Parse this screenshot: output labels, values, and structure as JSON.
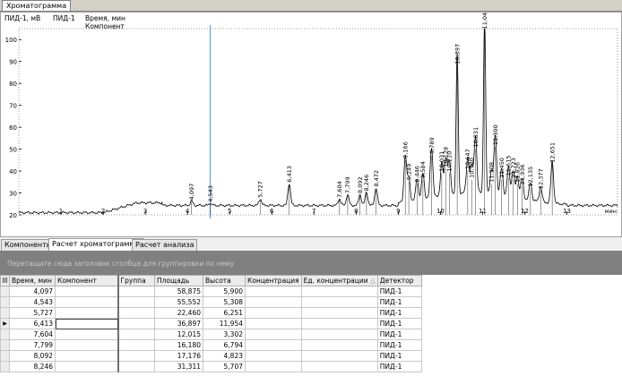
{
  "window": {
    "tab_label": "Хроматограмма"
  },
  "chromatogram": {
    "channel_unit": "ПИД-1, мВ",
    "detector": "ПИД-1",
    "time_label": "Время, мин",
    "component_label": "Компонент",
    "x_axis_unit": "мин",
    "chart_data": {
      "type": "line",
      "title": "",
      "xlabel": "Время, мин",
      "ylabel": "ПИД-1, мВ",
      "xlim": [
        0,
        14.2
      ],
      "ylim": [
        20,
        105
      ],
      "y_ticks": [
        20,
        30,
        40,
        50,
        60,
        70,
        80,
        90,
        100
      ],
      "x_ticks": [
        1,
        2,
        3,
        4,
        5,
        6,
        7,
        8,
        9,
        10,
        11,
        12,
        13
      ],
      "cursor_x": 4.54,
      "baseline": 21,
      "peaks": [
        {
          "x": 4.097,
          "y": 26,
          "label": "4,097"
        },
        {
          "x": 4.543,
          "y": 25,
          "label": "4,543"
        },
        {
          "x": 5.727,
          "y": 27,
          "label": "5,727"
        },
        {
          "x": 6.413,
          "y": 34,
          "label": "6,413"
        },
        {
          "x": 7.604,
          "y": 27,
          "label": "7,604"
        },
        {
          "x": 7.799,
          "y": 29,
          "label": "7,799"
        },
        {
          "x": 8.092,
          "y": 29,
          "label": "8,092"
        },
        {
          "x": 8.246,
          "y": 30,
          "label": "8,246"
        },
        {
          "x": 8.472,
          "y": 32,
          "label": "8,472"
        },
        {
          "x": 9.166,
          "y": 45,
          "label": "9,166"
        },
        {
          "x": 9.249,
          "y": 35,
          "label": "9,249"
        },
        {
          "x": 9.446,
          "y": 34,
          "label": "9,446"
        },
        {
          "x": 9.584,
          "y": 36,
          "label": "9,584"
        },
        {
          "x": 9.789,
          "y": 47,
          "label": "9,789"
        },
        {
          "x": 10.031,
          "y": 39,
          "label": "10,031"
        },
        {
          "x": 10.128,
          "y": 41,
          "label": "10,128"
        },
        {
          "x": 10.21,
          "y": 39,
          "label": "10,210"
        },
        {
          "x": 10.397,
          "y": 88,
          "label": "10,397"
        },
        {
          "x": 10.647,
          "y": 40,
          "label": "10,647"
        },
        {
          "x": 10.74,
          "y": 36,
          "label": "10,740"
        },
        {
          "x": 10.831,
          "y": 50,
          "label": "10,831"
        },
        {
          "x": 11.047,
          "y": 104,
          "label": "11,047"
        },
        {
          "x": 11.208,
          "y": 34,
          "label": "11,208"
        },
        {
          "x": 11.3,
          "y": 51,
          "label": "11,300"
        },
        {
          "x": 11.45,
          "y": 36,
          "label": "11,450"
        },
        {
          "x": 11.615,
          "y": 37,
          "label": "11,615"
        },
        {
          "x": 11.723,
          "y": 36,
          "label": "11,723"
        },
        {
          "x": 11.826,
          "y": 34,
          "label": "11,826"
        },
        {
          "x": 11.936,
          "y": 33,
          "label": "11,936"
        },
        {
          "x": 12.135,
          "y": 32,
          "label": "12,135"
        },
        {
          "x": 12.377,
          "y": 31,
          "label": "12,377"
        },
        {
          "x": 12.651,
          "y": 43,
          "label": "12,651"
        }
      ]
    }
  },
  "lower_tabs": [
    "Компоненты",
    "Расчет хроматограммы",
    "Расчет анализа"
  ],
  "grid": {
    "group_hint": "Перетащите сюда заголовок столбца для группировки по нему",
    "columns": [
      "Время, мин",
      "Компонент",
      "Группа",
      "Площадь",
      "Высота",
      "Концентрация",
      "Ед. концентрации",
      "Детектор"
    ],
    "rows": [
      {
        "time": "4,097",
        "component": "",
        "group": "",
        "area": "58,875",
        "height": "5,900",
        "conc": "",
        "unit": "",
        "detector": "ПИД-1"
      },
      {
        "time": "4,543",
        "component": "",
        "group": "",
        "area": "55,552",
        "height": "5,308",
        "conc": "",
        "unit": "",
        "detector": "ПИД-1"
      },
      {
        "time": "5,727",
        "component": "",
        "group": "",
        "area": "22,460",
        "height": "6,251",
        "conc": "",
        "unit": "",
        "detector": "ПИД-1"
      },
      {
        "time": "6,413",
        "component": "",
        "group": "",
        "area": "36,897",
        "height": "11,954",
        "conc": "",
        "unit": "",
        "detector": "ПИД-1"
      },
      {
        "time": "7,604",
        "component": "",
        "group": "",
        "area": "12,015",
        "height": "3,302",
        "conc": "",
        "unit": "",
        "detector": "ПИД-1"
      },
      {
        "time": "7,799",
        "component": "",
        "group": "",
        "area": "16,180",
        "height": "6,794",
        "conc": "",
        "unit": "",
        "detector": "ПИД-1"
      },
      {
        "time": "8,092",
        "component": "",
        "group": "",
        "area": "17,176",
        "height": "4,823",
        "conc": "",
        "unit": "",
        "detector": "ПИД-1"
      },
      {
        "time": "8,246",
        "component": "",
        "group": "",
        "area": "31,311",
        "height": "5,707",
        "conc": "",
        "unit": "",
        "detector": "ПИД-1"
      }
    ],
    "current_row": 3
  },
  "colors": {
    "trace": "#000000",
    "cursor": "#4a90d9",
    "group_panel": "#808080"
  }
}
